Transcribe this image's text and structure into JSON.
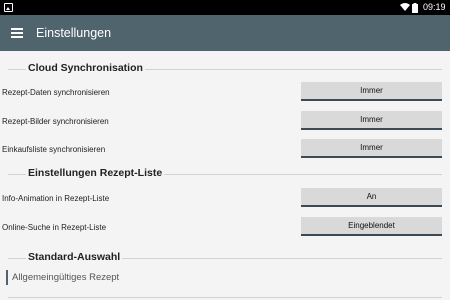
{
  "status_bar": {
    "time": "09:19",
    "icons": [
      "image-icon",
      "wifi-icon",
      "battery-icon"
    ]
  },
  "app_bar": {
    "title": "Einstellungen",
    "menu_icon": "hamburger-menu-icon"
  },
  "sections": {
    "cloud": {
      "title": "Cloud Synchronisation",
      "rows": [
        {
          "label": "Rezept-Daten synchronisieren",
          "value": "Immer"
        },
        {
          "label": "Rezept-Bilder synchronisieren",
          "value": "Immer"
        },
        {
          "label": "Einkaufsliste synchronisieren",
          "value": "Immer"
        }
      ]
    },
    "recipe_list": {
      "title": "Einstellungen Rezept-Liste",
      "rows": [
        {
          "label": "Info-Animation in Rezept-Liste",
          "value": "An"
        },
        {
          "label": "Online-Suche in Rezept-Liste",
          "value": "Eingeblendet"
        }
      ]
    },
    "standard": {
      "title": "Standard-Auswahl",
      "item": "Allgemeingültiges Rezept"
    }
  },
  "colors": {
    "app_bar": "#50646e",
    "button_bg": "#d9d9d9",
    "button_underline": "#3b4a54",
    "background": "#f4f4f4"
  }
}
